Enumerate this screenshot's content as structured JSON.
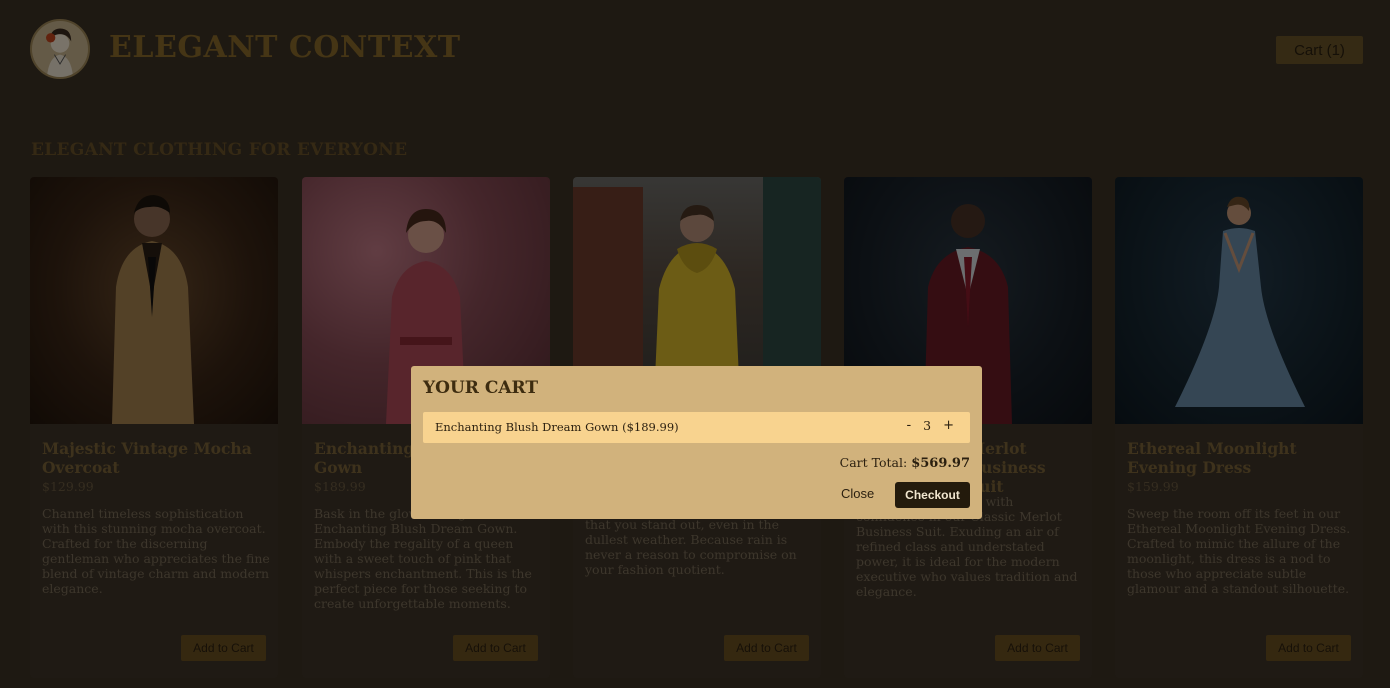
{
  "header": {
    "brand": "ELEGANT CONTEXT",
    "cart_label": "Cart (1)"
  },
  "section_title": "ELEGANT CLOTHING FOR EVERYONE",
  "products": [
    {
      "name": "Majestic Vintage Mocha Overcoat",
      "price": "$129.99",
      "description": "Channel timeless sophistication with this stunning mocha overcoat. Crafted for the discerning gentleman who appreciates the fine blend of vintage charm and modern elegance.",
      "add_label": "Add to Cart"
    },
    {
      "name": "Enchanting Blush Dream Gown",
      "price": "$189.99",
      "description": "Bask in the glow of elegance in our Enchanting Blush Dream Gown. Embody the regality of a queen with a sweet touch of pink that whispers enchantment. This is the perfect piece for those seeking to create unforgettable moments.",
      "add_label": "Add to Cart"
    },
    {
      "name": "",
      "price": "",
      "description": "that you stand out, even in the dullest weather. Because rain is never a reason to compromise on your fashion quotient.",
      "add_label": "Add to Cart"
    },
    {
      "name": "Merlot Business Suit",
      "price": "",
      "description": "Command the room with confidence in our Classic Merlot Business Suit. Exuding an air of refined class and understated power, it is ideal for the modern executive who values tradition and elegance.",
      "add_label": "Add to Cart"
    },
    {
      "name": "Ethereal Moonlight Evening Dress",
      "price": "$159.99",
      "description": "Sweep the room off its feet in our Ethereal Moonlight Evening Dress. Crafted to mimic the allure of the moonlight, this dress is a nod to those who appreciate subtle glamour and a standout silhouette.",
      "add_label": "Add to Cart"
    }
  ],
  "cart_modal": {
    "title": "YOUR CART",
    "items": [
      {
        "label": "Enchanting Blush Dream Gown ($189.99)",
        "quantity": "3",
        "minus": "-",
        "plus": "+"
      }
    ],
    "total_label": "Cart Total:",
    "total_value": "$569.97",
    "close_label": "Close",
    "checkout_label": "Checkout"
  },
  "colors": {
    "accent": "#6b5020",
    "modal_bg": "#d1b27c",
    "cart_row_bg": "#f8d38f",
    "checkout_bg": "#231a0c"
  }
}
